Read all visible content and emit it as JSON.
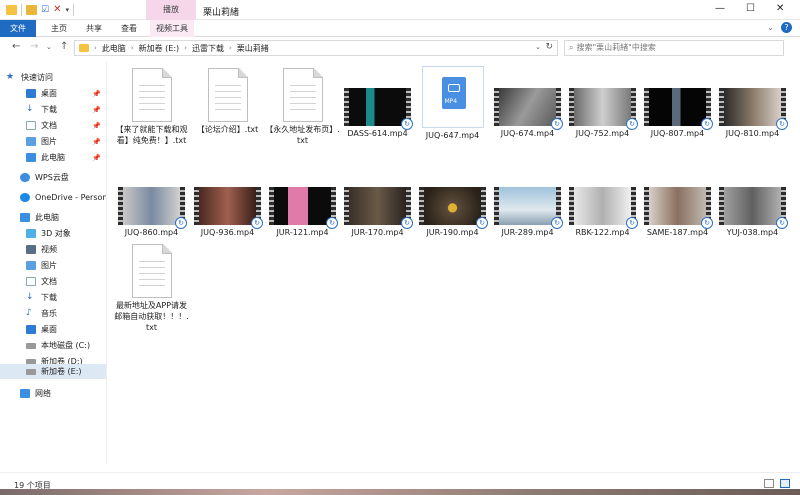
{
  "window": {
    "title": "栗山莉緒",
    "context_tab": "播放",
    "minimize": "—",
    "maximize": "☐",
    "close": "✕"
  },
  "ribbon": {
    "tabs": [
      "文件",
      "主页",
      "共享",
      "查看",
      "视频工具"
    ]
  },
  "address": {
    "crumbs": [
      "此电脑",
      "新加卷 (E:)",
      "迅雷下载",
      "栗山莉緒"
    ],
    "search_placeholder": "搜索\"栗山莉緒\"中搜索"
  },
  "sidebar": {
    "items": [
      {
        "label": "快速访问",
        "icon": "star-icon",
        "pinned": false
      },
      {
        "label": "桌面",
        "icon": "desktop-icon",
        "pinned": true
      },
      {
        "label": "下载",
        "icon": "download-icon",
        "pinned": true
      },
      {
        "label": "文档",
        "icon": "document-icon",
        "pinned": true
      },
      {
        "label": "图片",
        "icon": "picture-icon",
        "pinned": true
      },
      {
        "label": "此电脑",
        "icon": "computer-icon",
        "pinned": true
      },
      {
        "label": "WPS云盘",
        "icon": "cloud-icon",
        "pinned": false
      },
      {
        "label": "OneDrive - Persona",
        "icon": "onedrive-icon",
        "pinned": false
      },
      {
        "label": "此电脑",
        "icon": "computer-icon",
        "pinned": false
      },
      {
        "label": "3D 对象",
        "icon": "cube-icon",
        "pinned": false
      },
      {
        "label": "视频",
        "icon": "video-icon",
        "pinned": false
      },
      {
        "label": "图片",
        "icon": "picture-icon",
        "pinned": false
      },
      {
        "label": "文档",
        "icon": "document-icon",
        "pinned": false
      },
      {
        "label": "下载",
        "icon": "download-icon",
        "pinned": false
      },
      {
        "label": "音乐",
        "icon": "music-icon",
        "pinned": false
      },
      {
        "label": "桌面",
        "icon": "desktop-icon",
        "pinned": false
      },
      {
        "label": "本地磁盘 (C:)",
        "icon": "drive-icon",
        "pinned": false
      },
      {
        "label": "新加卷 (D:)",
        "icon": "drive-icon",
        "pinned": false
      },
      {
        "label": "新加卷 (E:)",
        "icon": "drive-icon",
        "pinned": false,
        "selected": true
      },
      {
        "label": "网络",
        "icon": "network-icon",
        "pinned": false
      }
    ]
  },
  "files": [
    {
      "name": "【来了就能下载和观看】纯免费！】.txt",
      "type": "txt"
    },
    {
      "name": "【论坛介绍】.txt",
      "type": "txt"
    },
    {
      "name": "【永久地址发布页】.txt",
      "type": "txt"
    },
    {
      "name": "DASS-614.mp4",
      "type": "video"
    },
    {
      "name": "JUQ-647.mp4",
      "type": "mp4icon"
    },
    {
      "name": "JUQ-674.mp4",
      "type": "video"
    },
    {
      "name": "JUQ-752.mp4",
      "type": "video"
    },
    {
      "name": "JUQ-807.mp4",
      "type": "video"
    },
    {
      "name": "JUQ-810.mp4",
      "type": "video"
    },
    {
      "name": "JUQ-860.mp4",
      "type": "video"
    },
    {
      "name": "JUQ-936.mp4",
      "type": "video"
    },
    {
      "name": "JUR-121.mp4",
      "type": "video"
    },
    {
      "name": "JUR-170.mp4",
      "type": "video"
    },
    {
      "name": "JUR-190.mp4",
      "type": "video"
    },
    {
      "name": "JUR-289.mp4",
      "type": "video"
    },
    {
      "name": "RBK-122.mp4",
      "type": "video"
    },
    {
      "name": "SAME-187.mp4",
      "type": "video"
    },
    {
      "name": "YUJ-038.mp4",
      "type": "video"
    },
    {
      "name": "最新地址及APP请发邮箱自动获取！！！.txt",
      "type": "txt"
    }
  ],
  "status": {
    "count": "19 个项目"
  },
  "colors": {
    "accent": "#1f6bc1",
    "context_tab": "#f6d7ea",
    "selection": "#dde8f5"
  }
}
